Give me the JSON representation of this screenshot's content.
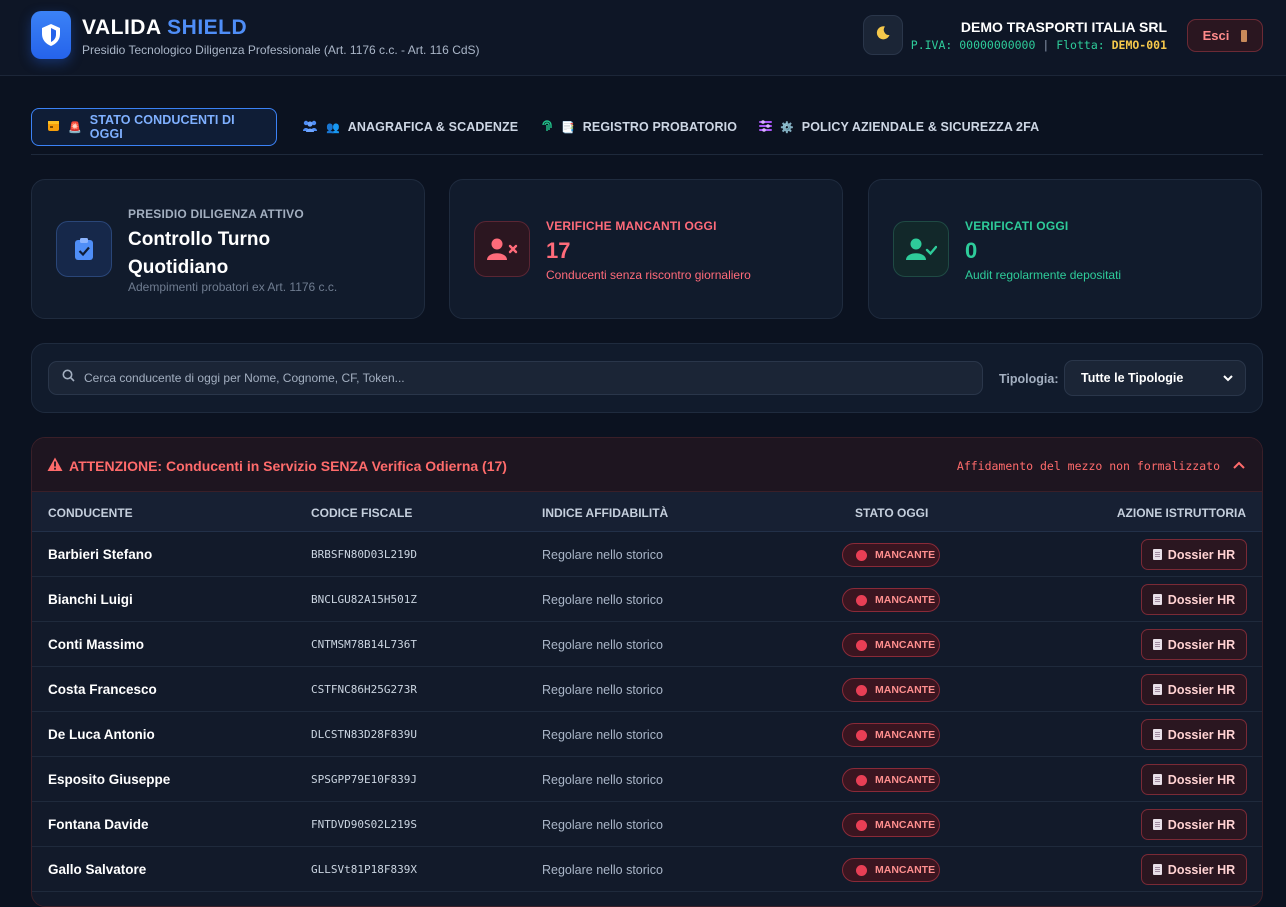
{
  "header": {
    "brand_main": "VALIDA",
    "brand_accent": "SHIELD",
    "subtitle": "Presidio Tecnologico Diligenza Professionale (Art. 1176 c.c. - Art. 116 CdS)",
    "company_name": "DEMO TRASPORTI ITALIA SRL",
    "piva_label": "P.IVA: 00000000000",
    "separator": "|",
    "fleet_label": "Flotta:",
    "fleet_value": "DEMO-001",
    "logout_label": "Esci",
    "accent_color": "#4f8ef7"
  },
  "tabs": [
    {
      "emoji": "🚨",
      "label": "STATO CONDUCENTI DI OGGI",
      "icon": "calendar-icon"
    },
    {
      "emoji": "👥",
      "label": "ANAGRAFICA & SCADENZE",
      "icon": "users-icon"
    },
    {
      "emoji": "📑",
      "label": "REGISTRO PROBATORIO",
      "icon": "fingerprint-icon"
    },
    {
      "emoji": "⚙️",
      "label": "POLICY AZIENDALE & SICUREZZA 2FA",
      "icon": "sliders-icon"
    }
  ],
  "cards": {
    "presidio": {
      "label": "PRESIDIO DILIGENZA ATTIVO",
      "title": "Controllo Turno Quotidiano",
      "note": "Adempimenti probatori ex Art. 1176 c.c."
    },
    "missing": {
      "label": "VERIFICHE MANCANTI OGGI",
      "value": "17",
      "note": "Conducenti senza riscontro giornaliero"
    },
    "verified": {
      "label": "VERIFICATI OGGI",
      "value": "0",
      "note": "Audit regolarmente depositati"
    }
  },
  "search": {
    "placeholder": "Cerca conducente di oggi per Nome, Cognome, CF, Token...",
    "filter_label": "Tipologia:",
    "filter_value": "Tutte le Tipologie"
  },
  "alert": {
    "title": "ATTENZIONE: Conducenti in Servizio SENZA Verifica Odierna (17)",
    "note": "Affidamento del mezzo non formalizzato",
    "columns": [
      "CONDUCENTE",
      "CODICE FISCALE",
      "INDICE AFFIDABILITÀ",
      "STATO OGGI",
      "AZIONE ISTRUTTORIA"
    ],
    "status_label": "MANCANTE",
    "action_label": "Dossier HR",
    "rows": [
      {
        "name": "Barbieri Stefano",
        "cf": "BRBSFN80D03L219D",
        "index": "Regolare nello storico"
      },
      {
        "name": "Bianchi Luigi",
        "cf": "BNCLGU82A15H501Z",
        "index": "Regolare nello storico"
      },
      {
        "name": "Conti Massimo",
        "cf": "CNTMSM78B14L736T",
        "index": "Regolare nello storico"
      },
      {
        "name": "Costa Francesco",
        "cf": "CSTFNC86H25G273R",
        "index": "Regolare nello storico"
      },
      {
        "name": "De Luca Antonio",
        "cf": "DLCSTN83D28F839U",
        "index": "Regolare nello storico"
      },
      {
        "name": "Esposito Giuseppe",
        "cf": "SPSGPP79E10F839J",
        "index": "Regolare nello storico"
      },
      {
        "name": "Fontana Davide",
        "cf": "FNTDVD90S02L219S",
        "index": "Regolare nello storico"
      },
      {
        "name": "Gallo Salvatore",
        "cf": "GLLSVt81P18F839X",
        "index": "Regolare nello storico"
      }
    ]
  }
}
